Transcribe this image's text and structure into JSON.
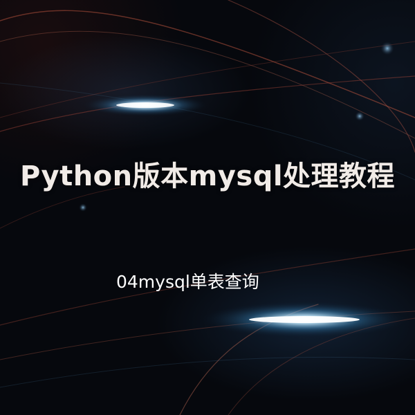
{
  "title": "Python版本mysql处理教程",
  "subtitle": "04mysql单表查询",
  "colors": {
    "background": "#06080d",
    "title_text": "#f1ebe7",
    "subtitle_text": "#ffffff",
    "streak_accent": "#9ad8ff",
    "line_accent": "#b0503c"
  }
}
